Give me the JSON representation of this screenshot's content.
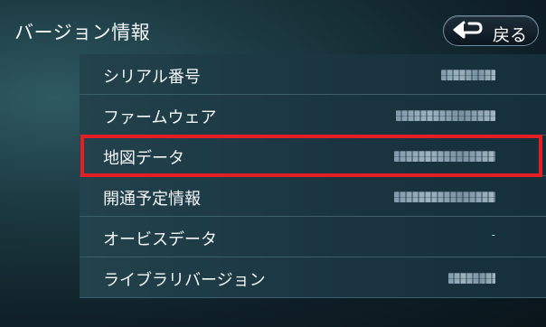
{
  "header": {
    "title": "バージョン情報",
    "back_label": "戻る"
  },
  "rows": [
    {
      "label": "シリアル番号",
      "value": "(redacted)",
      "value_obscured": true
    },
    {
      "label": "ファームウェア",
      "value": "(redacted)",
      "value_obscured": true
    },
    {
      "label": "地図データ",
      "value": "(redacted)",
      "value_obscured": true,
      "highlighted": true
    },
    {
      "label": "開通予定情報",
      "value": "(redacted)",
      "value_obscured": true
    },
    {
      "label": "オービスデータ",
      "value": "-",
      "value_obscured": false
    },
    {
      "label": "ライブラリバージョン",
      "value": "(redacted)",
      "value_obscured": true
    }
  ],
  "colors": {
    "highlight_border": "#e41e25",
    "accent_dash": "#8fe1ee"
  }
}
